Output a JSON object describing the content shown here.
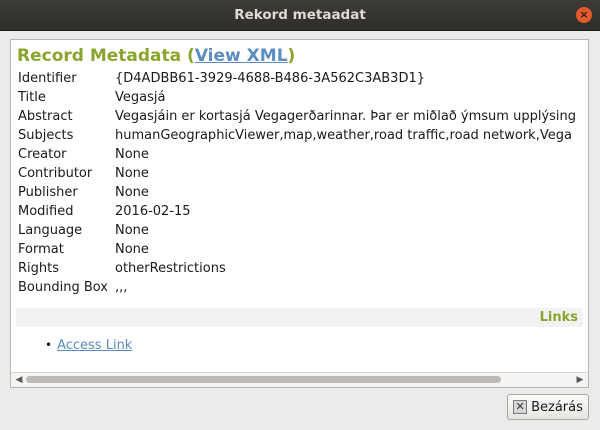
{
  "window": {
    "title": "Rekord metaadat",
    "close_glyph": "×"
  },
  "heading": {
    "prefix": "Record Metadata (",
    "link": "View XML",
    "suffix": ")"
  },
  "metadata": [
    {
      "key": "Identifier",
      "value": "{D4ADBB61-3929-4688-B486-3A562C3AB3D1}"
    },
    {
      "key": "Title",
      "value": "Vegasjá"
    },
    {
      "key": "Abstract",
      "value": "Vegasjáin er kortasjá Vegagerðarinnar. Þar er miðlað ýmsum upplýsing"
    },
    {
      "key": "Subjects",
      "value": "humanGeographicViewer,map,weather,road traffic,road network,Vega"
    },
    {
      "key": "Creator",
      "value": "None"
    },
    {
      "key": "Contributor",
      "value": "None"
    },
    {
      "key": "Publisher",
      "value": "None"
    },
    {
      "key": "Modified",
      "value": "2016-02-15"
    },
    {
      "key": "Language",
      "value": "None"
    },
    {
      "key": "Format",
      "value": "None"
    },
    {
      "key": "Rights",
      "value": "otherRestrictions"
    },
    {
      "key": "Bounding Box",
      "value": ",,,"
    }
  ],
  "links": {
    "header": "Links",
    "bullet": "•",
    "items": [
      "Access Link"
    ]
  },
  "scrollbar": {
    "left_arrow": "◀",
    "right_arrow": "▶"
  },
  "footer": {
    "close_label": "Bezárás",
    "close_icon_glyph": "✕"
  }
}
